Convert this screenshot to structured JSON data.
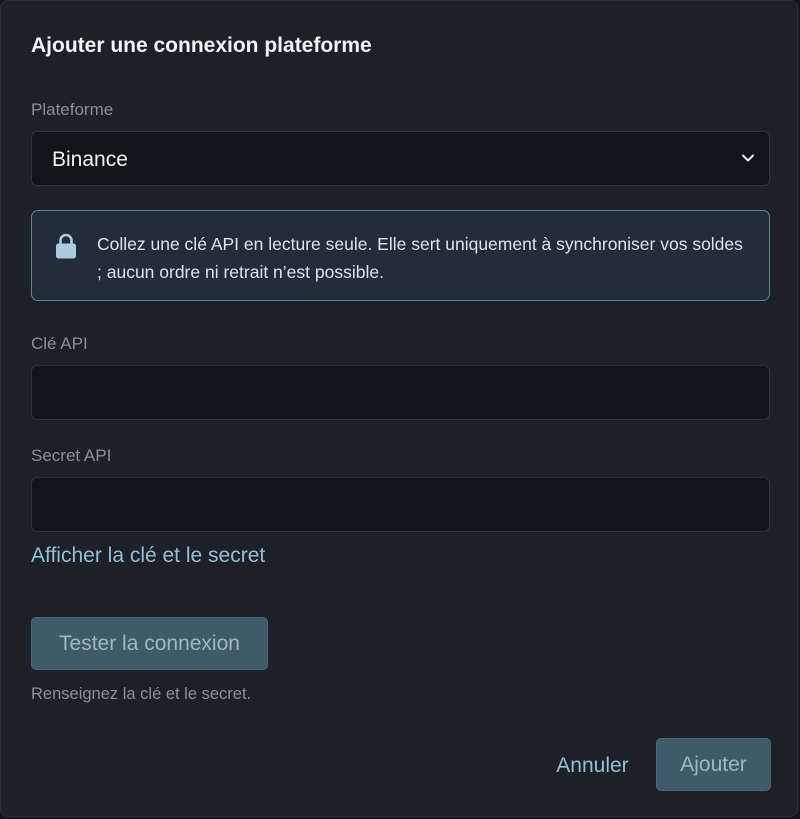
{
  "dialog": {
    "title": "Ajouter une connexion plateforme"
  },
  "platform": {
    "label": "Plateforme",
    "selected": "Binance",
    "icon": "chevron-down-icon"
  },
  "notice": {
    "icon": "lock-icon",
    "text": "Collez une clé API en lecture seule. Elle sert uniquement à synchroniser vos soldes ; aucun ordre ni retrait n’est possible."
  },
  "api_key": {
    "label": "Clé API",
    "value": ""
  },
  "api_secret": {
    "label": "Secret API",
    "value": ""
  },
  "reveal_link": "Afficher la clé et le secret",
  "test_button": "Tester la connexion",
  "hint": "Renseignez la clé et le secret.",
  "footer": {
    "cancel": "Annuler",
    "add": "Ajouter"
  },
  "colors": {
    "dialog_bg": "#1d2027",
    "field_bg": "#121419",
    "notice_bg": "#232c38",
    "notice_border": "#5c8799",
    "accent": "#8fc0d8",
    "button_disabled": "#3e5b6b"
  }
}
